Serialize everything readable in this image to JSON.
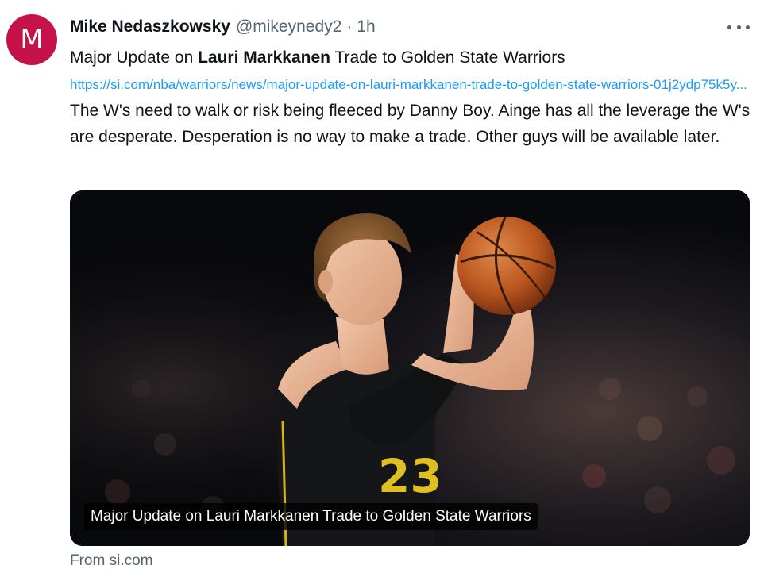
{
  "author": {
    "avatar_letter": "M",
    "avatar_color": "#c5134a",
    "display_name": "Mike Nedaszkowsky",
    "handle": "@mikeynedy2",
    "separator": "·",
    "time": "1h"
  },
  "tweet": {
    "title_prefix": "Major Update on ",
    "title_strong": "Lauri Markkanen",
    "title_suffix": " Trade to Golden State Warriors",
    "link_text": "https://si.com/nba/warriors/news/major-update-on-lauri-markkanen-trade-to-golden-state-warriors-01j2ydp75k5y...",
    "body_text": " The W's need to walk or risk being fleeced by Danny Boy. Ainge has all the leverage the W's are desperate. Desperation is no way to make a trade. Other guys will be available later."
  },
  "card": {
    "caption": "Major Update on Lauri Markkanen Trade to Golden State Warriors",
    "jersey_number": "23",
    "source_label": "From si.com"
  },
  "icons": {
    "more": "more-horizontal-icon"
  },
  "colors": {
    "text_primary": "#0f1419",
    "text_secondary": "#536471",
    "link": "#1d9bf0",
    "avatar": "#c5134a"
  }
}
